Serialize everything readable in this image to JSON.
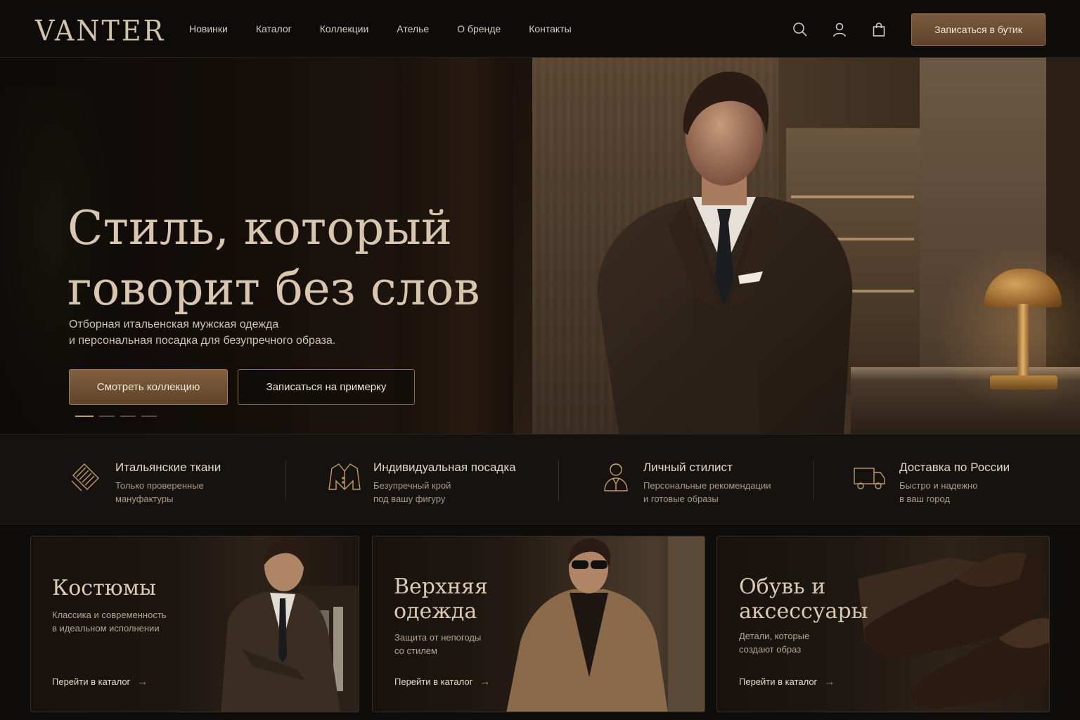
{
  "brand": {
    "logo": "VANTER"
  },
  "nav": {
    "items": [
      {
        "label": "Новинки"
      },
      {
        "label": "Каталог"
      },
      {
        "label": "Коллекции"
      },
      {
        "label": "Ателье"
      },
      {
        "label": "О бренде"
      },
      {
        "label": "Контакты"
      }
    ],
    "icons": [
      "search-icon",
      "user-icon",
      "bag-icon"
    ],
    "cta_label": "Записаться в бутик"
  },
  "hero": {
    "title_line1": "Стиль, который",
    "title_line2": "говорит без слов",
    "subtitle_line1": "Отборная итальенская мужская одежда",
    "subtitle_line2": "и персональная посадка для безупречного образа.",
    "primary_label": "Смотреть коллекцию",
    "secondary_label": "Записаться на примерку",
    "slides_total": 4,
    "slide_active": 1
  },
  "features": [
    {
      "icon": "fabric-icon",
      "title": "Итальянские ткани",
      "desc_line1": "Только проверенные",
      "desc_line2": "мануфактуры"
    },
    {
      "icon": "jacket-icon",
      "title": "Индивидуальная посадка",
      "desc_line1": "Безупречный крой",
      "desc_line2": "под вашу фигуру"
    },
    {
      "icon": "stylist-icon",
      "title": "Личный стилист",
      "desc_line1": "Персональные рекомендации",
      "desc_line2": "и готовые образы"
    },
    {
      "icon": "truck-icon",
      "title": "Доставка по России",
      "desc_line1": "Быстро и надежно",
      "desc_line2": "в ваш город"
    }
  ],
  "categories": [
    {
      "title_line1": "Костюмы",
      "title_line2": "",
      "desc_line1": "Классика и современность",
      "desc_line2": "в идеальном исполнении",
      "link": "Перейти в каталог"
    },
    {
      "title_line1": "Верхняя",
      "title_line2": "одежда",
      "desc_line1": "Защита от непогоды",
      "desc_line2": "со стилем",
      "link": "Перейти в каталог"
    },
    {
      "title_line1": "Обувь и",
      "title_line2": "аксессуары",
      "desc_line1": "Детали, которые",
      "desc_line2": "создают образ",
      "link": "Перейти в каталог"
    }
  ],
  "colors": {
    "accent": "#c49a63",
    "background": "#0f0d0b",
    "button": "#6e5033"
  }
}
